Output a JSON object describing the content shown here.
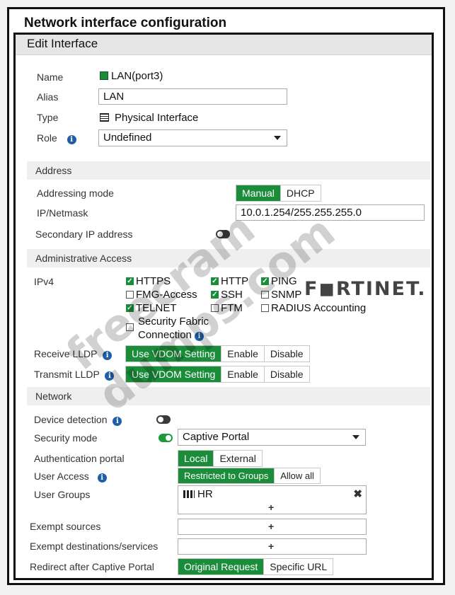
{
  "page_title": "Network interface configuration",
  "dialog_title": "Edit Interface",
  "fields": {
    "name_label": "Name",
    "name_value": "LAN(port3)",
    "alias_label": "Alias",
    "alias_value": "LAN",
    "type_label": "Type",
    "type_value": "Physical Interface",
    "role_label": "Role",
    "role_value": "Undefined"
  },
  "address": {
    "section": "Address",
    "mode_label": "Addressing mode",
    "mode_options": [
      "Manual",
      "DHCP"
    ],
    "mode_selected": "Manual",
    "ip_label": "IP/Netmask",
    "ip_value": "10.0.1.254/255.255.255.0",
    "secondary_label": "Secondary IP address",
    "secondary_enabled": false
  },
  "admin_access": {
    "section": "Administrative Access",
    "ipv4_label": "IPv4",
    "options": [
      {
        "label": "HTTPS",
        "checked": true
      },
      {
        "label": "HTTP",
        "checked": true
      },
      {
        "label": "PING",
        "checked": true
      },
      {
        "label": "FMG-Access",
        "checked": false
      },
      {
        "label": "SSH",
        "checked": true
      },
      {
        "label": "SNMP",
        "checked": false
      },
      {
        "label": "TELNET",
        "checked": true
      },
      {
        "label": "FTM",
        "checked": false
      },
      {
        "label": "RADIUS Accounting",
        "checked": false
      }
    ],
    "fabric_line1": "Security Fabric",
    "fabric_line2": "Connection",
    "fabric_checked": false,
    "receive_lldp_label": "Receive LLDP",
    "transmit_lldp_label": "Transmit LLDP",
    "lldp_options": [
      "Use VDOM Setting",
      "Enable",
      "Disable"
    ],
    "lldp_selected": "Use VDOM Setting"
  },
  "network": {
    "section": "Network",
    "device_detection_label": "Device detection",
    "device_detection_enabled": false,
    "security_mode_label": "Security mode",
    "security_mode_enabled": true,
    "security_mode_value": "Captive Portal",
    "auth_portal_label": "Authentication portal",
    "auth_portal_options": [
      "Local",
      "External"
    ],
    "auth_portal_selected": "Local",
    "user_access_label": "User Access",
    "user_access_options": [
      "Restricted to Groups",
      "Allow all"
    ],
    "user_access_selected": "Restricted to Groups",
    "user_groups_label": "User Groups",
    "user_groups": [
      "HR"
    ],
    "exempt_sources_label": "Exempt sources",
    "exempt_dest_label": "Exempt destinations/services",
    "redirect_label": "Redirect after Captive Portal",
    "redirect_options": [
      "Original Request",
      "Specific URL"
    ],
    "redirect_selected": "Original Request"
  },
  "overlays": {
    "watermark": "freecram dumps.com",
    "brand": "F◼RTINET."
  },
  "colors": {
    "accent_green": "#1a8c3a",
    "info_blue": "#1f5fa8"
  }
}
